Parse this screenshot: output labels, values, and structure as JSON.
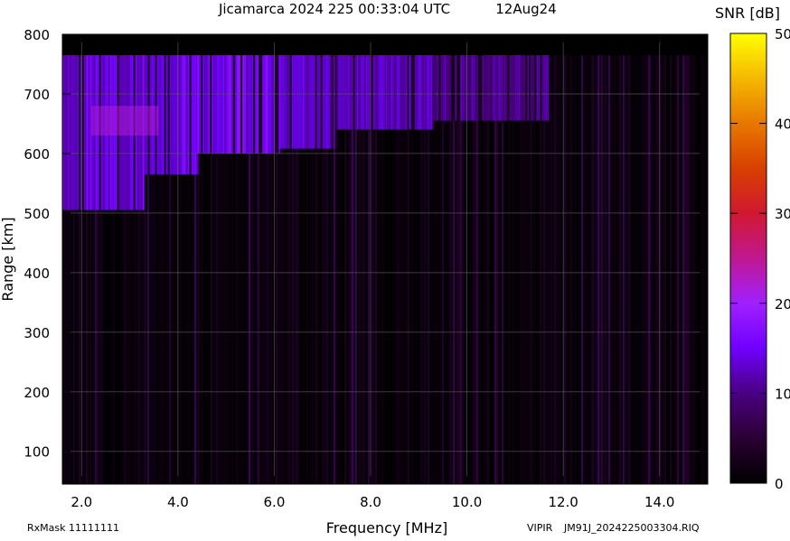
{
  "chart_data": {
    "type": "heatmap",
    "title": "Jicamarca 2024 225 00:33:04 UTC",
    "date_label": "12Aug24",
    "xlabel": "Frequency [MHz]",
    "ylabel": "Range [km]",
    "xlim": [
      1.6,
      15.0
    ],
    "ylim": [
      45,
      800
    ],
    "x_ticks": [
      2.0,
      4.0,
      6.0,
      8.0,
      10.0,
      12.0,
      14.0
    ],
    "x_tick_labels": [
      "2.0",
      "4.0",
      "6.0",
      "8.0",
      "10.0",
      "12.0",
      "14.0"
    ],
    "y_ticks": [
      100,
      200,
      300,
      400,
      500,
      600,
      700,
      800
    ],
    "y_tick_labels": [
      "100",
      "200",
      "300",
      "400",
      "500",
      "600",
      "700",
      "800"
    ],
    "grid": true,
    "colorbar": {
      "label": "SNR [dB]",
      "range": [
        0,
        50
      ],
      "ticks": [
        0,
        10,
        20,
        30,
        40,
        50
      ],
      "tick_labels": [
        "0",
        "10",
        "20",
        "30",
        "40",
        "50"
      ],
      "colors": [
        "#000000",
        "#2a0033",
        "#4a0080",
        "#7000ff",
        "#a020ff",
        "#c01890",
        "#d01830",
        "#d84000",
        "#e87800",
        "#f5b800",
        "#ffff00"
      ]
    },
    "data_extent_km": 765,
    "echo_regions": [
      {
        "freq_start": 1.6,
        "freq_end": 2.1,
        "range_low": 505,
        "range_high": 765,
        "snr": 13
      },
      {
        "freq_start": 2.1,
        "freq_end": 3.3,
        "range_low": 505,
        "range_high": 765,
        "snr": 15
      },
      {
        "freq_start": 3.3,
        "freq_end": 4.4,
        "range_low": 565,
        "range_high": 765,
        "snr": 15
      },
      {
        "freq_start": 4.4,
        "freq_end": 6.1,
        "range_low": 600,
        "range_high": 765,
        "snr": 16
      },
      {
        "freq_start": 6.1,
        "freq_end": 7.3,
        "range_low": 608,
        "range_high": 765,
        "snr": 14
      },
      {
        "freq_start": 7.3,
        "freq_end": 9.3,
        "range_low": 640,
        "range_high": 765,
        "snr": 13
      },
      {
        "freq_start": 9.3,
        "freq_end": 11.7,
        "range_low": 655,
        "range_high": 765,
        "snr": 11
      }
    ],
    "hot_spot": {
      "freq_start": 2.2,
      "freq_end": 3.6,
      "range_low": 630,
      "range_high": 680,
      "snr": 22
    }
  },
  "footer": {
    "rx_mask": "RxMask 11111111",
    "instrument": "VIPIR",
    "filename": "JM91J_2024225003304.RIQ"
  }
}
